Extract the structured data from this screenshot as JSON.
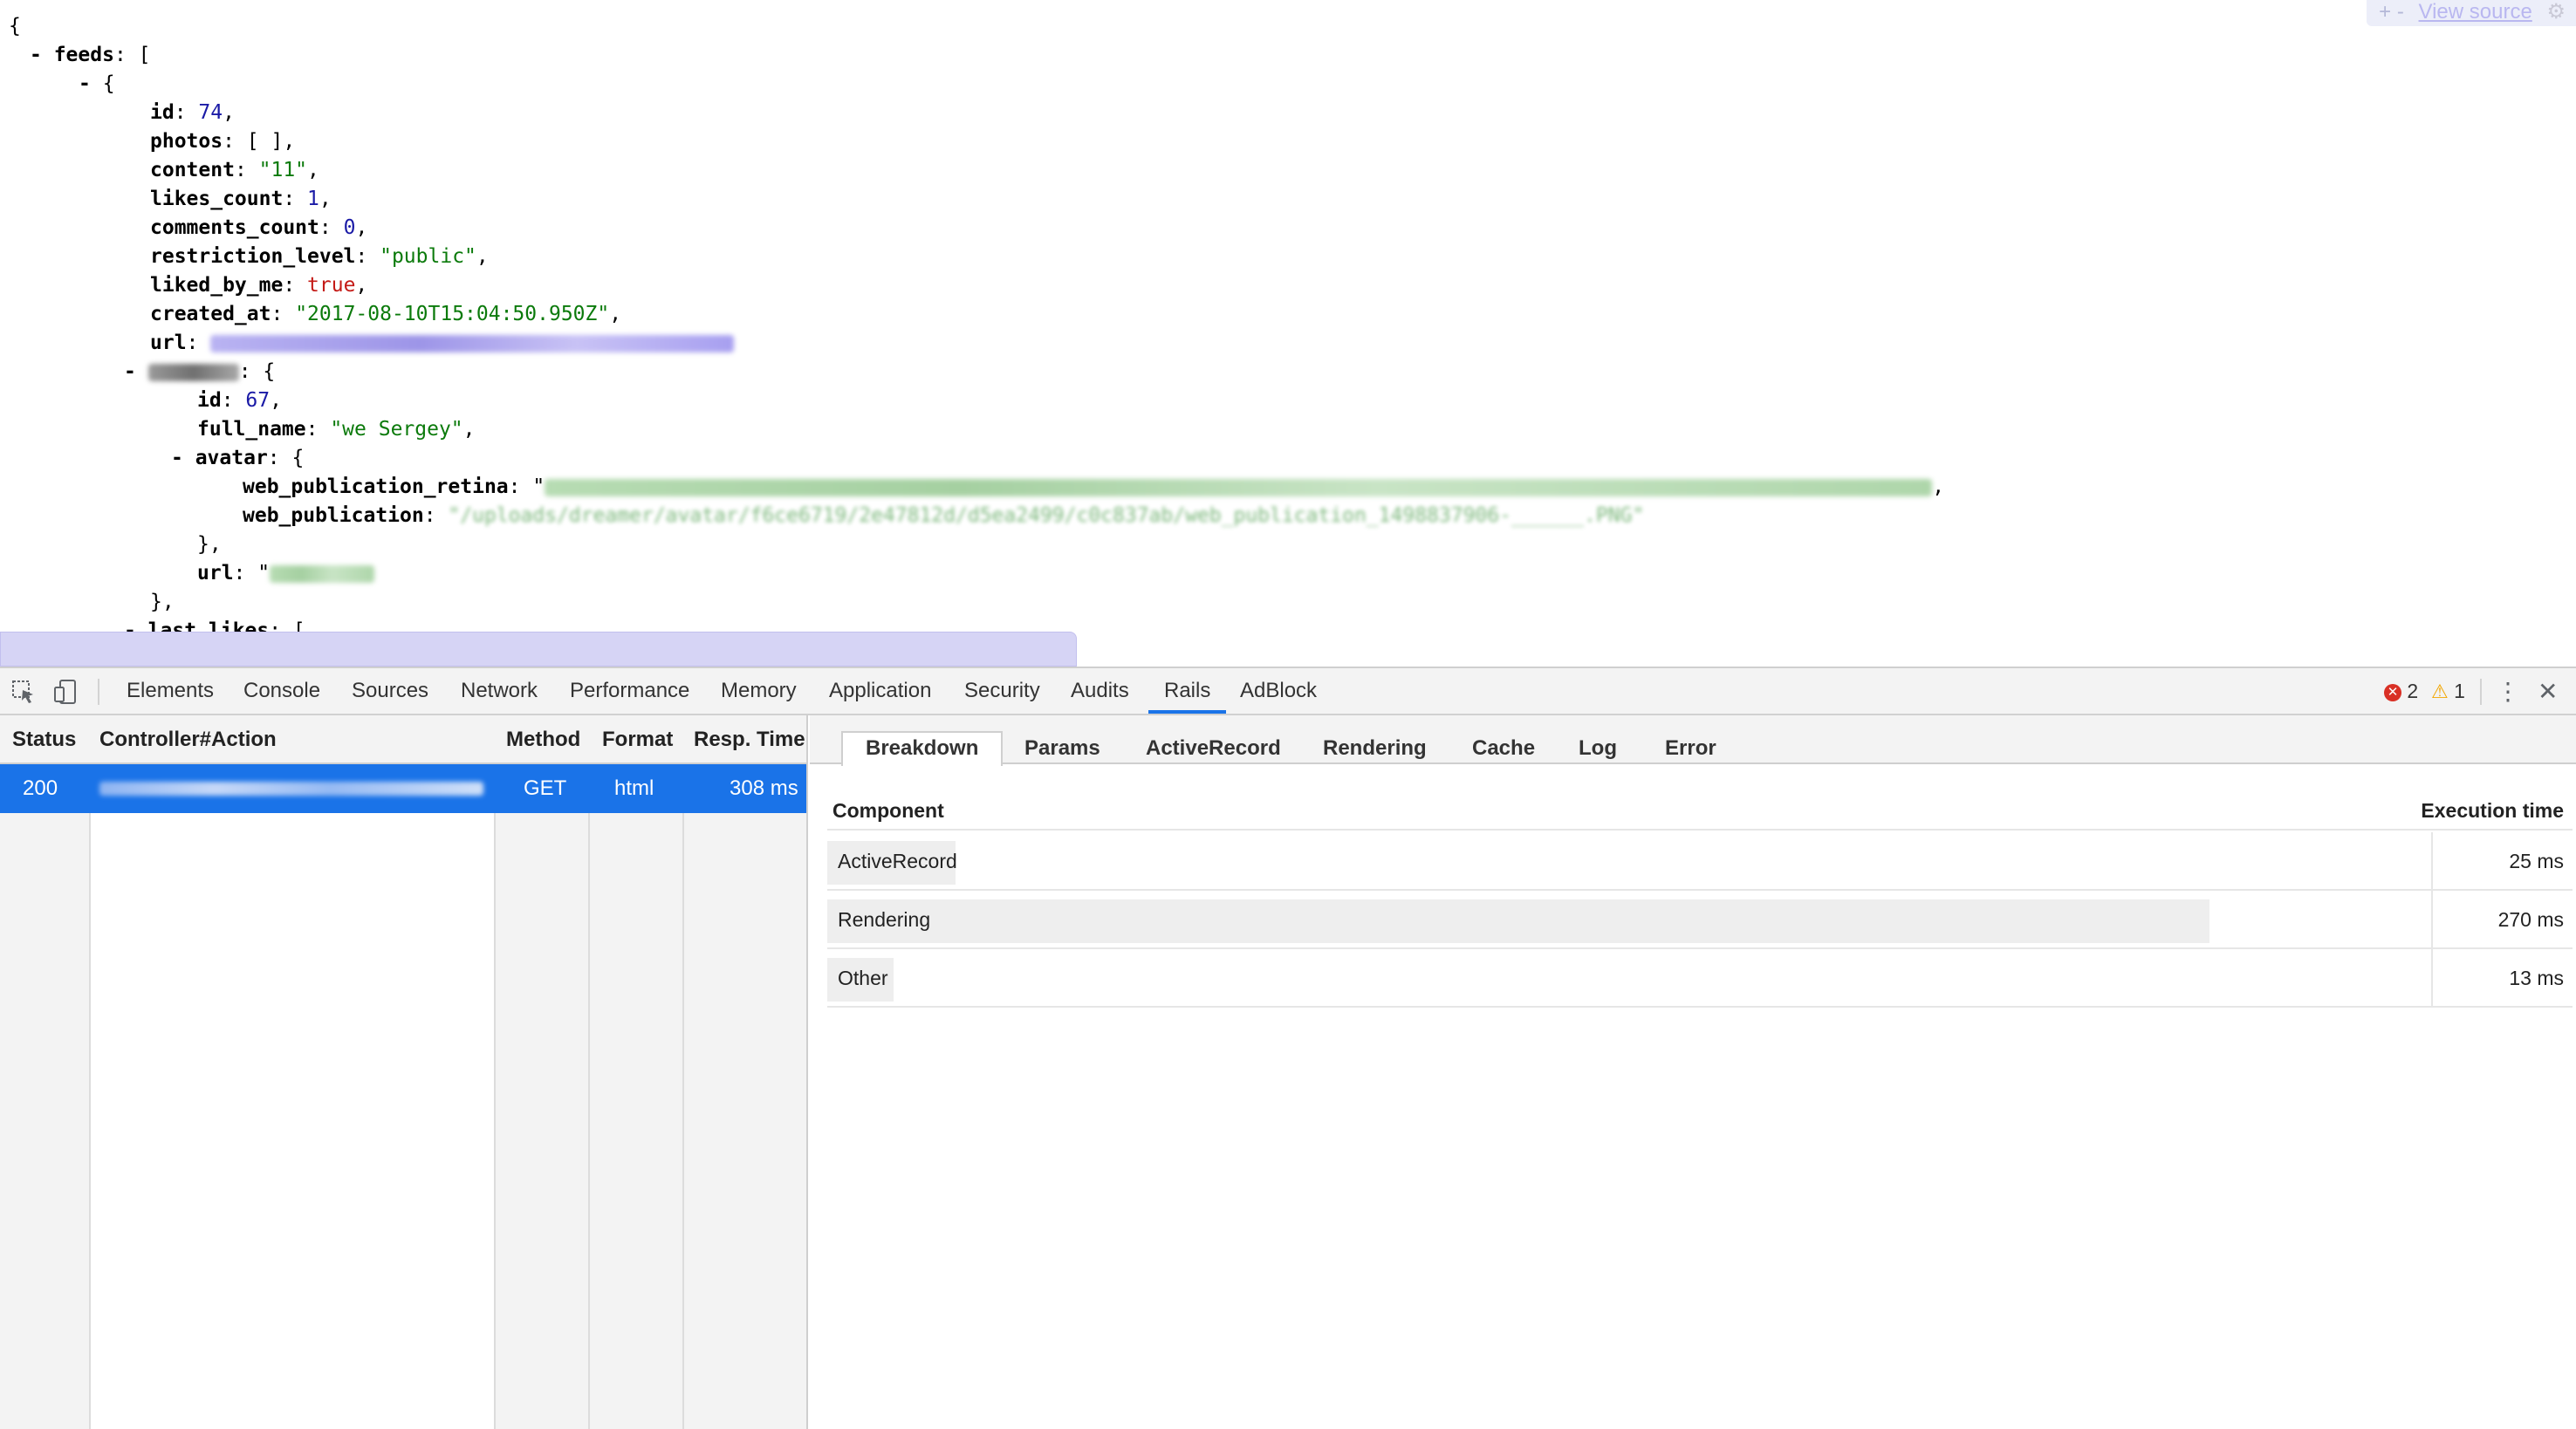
{
  "json_view": {
    "open_brace": "{",
    "feeds_key": "feeds",
    "feed": {
      "id": "74",
      "photos": "[ ]",
      "content": "\"11\"",
      "likes_count": "1",
      "comments_count": "0",
      "restriction_level": "\"public\"",
      "liked_by_me": "true",
      "created_at": "\"2017-08-10T15:04:50.950Z\"",
      "user_id": "67",
      "user_full_name": "\"we Sergey\"",
      "web_publication_suffix": "\"/uploads/dreamer/avatar/f6ce6719/2e47812d/d5ea2499/c0c837ab/web_publication_1498837906-______.PNG\""
    },
    "keys": {
      "id": "id",
      "photos": "photos",
      "content": "content",
      "likes_count": "likes_count",
      "comments_count": "comments_count",
      "restriction_level": "restriction_level",
      "liked_by_me": "liked_by_me",
      "created_at": "created_at",
      "url": "url",
      "full_name": "full_name",
      "avatar": "avatar",
      "web_publication_retina": "web_publication_retina",
      "web_publication": "web_publication",
      "last_likes": "last_likes"
    },
    "view_source": {
      "plus": "+",
      "minus": "-",
      "label": "View source"
    }
  },
  "devtools": {
    "tabs": [
      "Elements",
      "Console",
      "Sources",
      "Network",
      "Performance",
      "Memory",
      "Application",
      "Security",
      "Audits",
      "Rails",
      "AdBlock"
    ],
    "active_tab": "Rails",
    "error_count": "2",
    "warning_count": "1",
    "requests": {
      "headers": [
        "Status",
        "Controller#Action",
        "Method",
        "Format",
        "Resp. Time"
      ],
      "rows": [
        {
          "status": "200",
          "method": "GET",
          "format": "html",
          "resp_time": "308 ms"
        }
      ]
    },
    "detail_tabs": [
      "Breakdown",
      "Params",
      "ActiveRecord",
      "Rendering",
      "Cache",
      "Log",
      "Error"
    ],
    "active_detail_tab": "Breakdown",
    "breakdown": {
      "headers": {
        "component": "Component",
        "time": "Execution time"
      },
      "rows": [
        {
          "component": "ActiveRecord",
          "time": "25 ms",
          "ms": 25
        },
        {
          "component": "Rendering",
          "time": "270 ms",
          "ms": 270
        },
        {
          "component": "Other",
          "time": "13 ms",
          "ms": 13
        }
      ]
    }
  }
}
